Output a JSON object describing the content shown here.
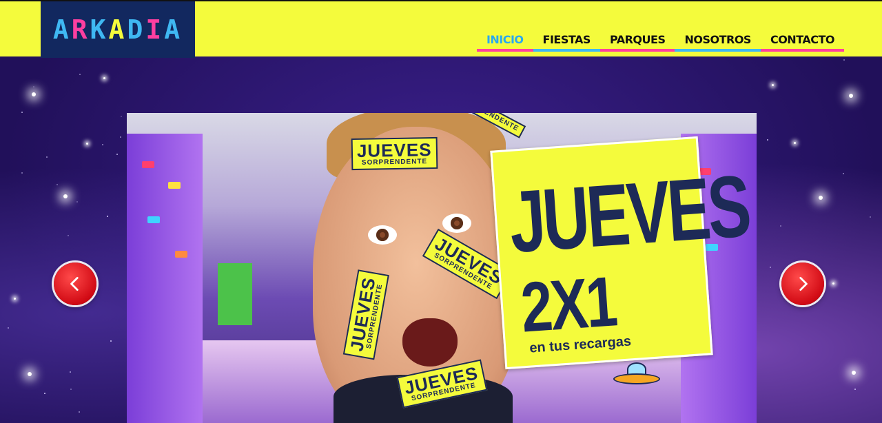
{
  "brand": {
    "letters": [
      {
        "char": "A",
        "color": "#3fb8f2"
      },
      {
        "char": "R",
        "color": "#ff3fa0"
      },
      {
        "char": "K",
        "color": "#3fb8f2"
      },
      {
        "char": "A",
        "color": "#f4fb3c"
      },
      {
        "char": "D",
        "color": "#3fb8f2"
      },
      {
        "char": "I",
        "color": "#ff3fa0"
      },
      {
        "char": "A",
        "color": "#3fb8f2"
      }
    ]
  },
  "nav": {
    "items": [
      {
        "label": "INICIO",
        "underline": "#ff3fa0",
        "active": true
      },
      {
        "label": "FIESTAS",
        "underline": "#3fb8f2",
        "active": false
      },
      {
        "label": "PARQUES",
        "underline": "#ff3fa0",
        "active": false
      },
      {
        "label": "NOSOTROS",
        "underline": "#3fb8f2",
        "active": false
      },
      {
        "label": "CONTACTO",
        "underline": "#ff3fa0",
        "active": false
      }
    ]
  },
  "slide": {
    "sticker_big": "JUEVES",
    "sticker_small": "SORPRENDENTE",
    "poster_title": "JUEVES",
    "poster_offer": "2X1",
    "poster_sub": "en tus recargas"
  },
  "controls": {
    "prev_icon": "chevron-left-icon",
    "next_icon": "chevron-right-icon"
  },
  "colors": {
    "header_bg": "#f4fb3c",
    "logo_bg": "#12285f",
    "accent_blue": "#3fb8f2",
    "accent_pink": "#ff3fa0",
    "arrow_red": "#d10a14"
  }
}
